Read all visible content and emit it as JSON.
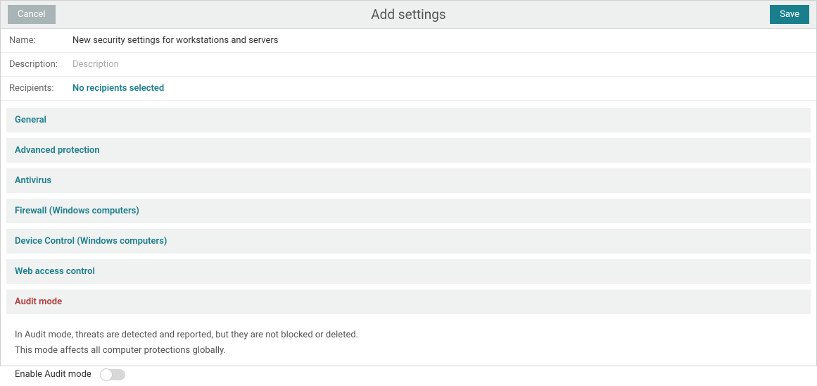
{
  "header": {
    "cancel_label": "Cancel",
    "title": "Add settings",
    "save_label": "Save"
  },
  "form": {
    "name_label": "Name:",
    "name_value": "New security settings for workstations and servers",
    "description_label": "Description:",
    "description_placeholder": "Description",
    "description_value": "",
    "recipients_label": "Recipients:",
    "recipients_value": "No recipients selected"
  },
  "sections": [
    {
      "label": "General"
    },
    {
      "label": "Advanced protection"
    },
    {
      "label": "Antivirus"
    },
    {
      "label": "Firewall (Windows computers)"
    },
    {
      "label": "Device Control (Windows computers)"
    },
    {
      "label": "Web access control"
    },
    {
      "label": "Audit mode"
    }
  ],
  "audit": {
    "line1": "In Audit mode, threats are detected and reported, but they are not blocked or deleted.",
    "line2": "This mode affects all computer protections globally.",
    "toggle_label": "Enable Audit mode",
    "toggle_state": false
  }
}
